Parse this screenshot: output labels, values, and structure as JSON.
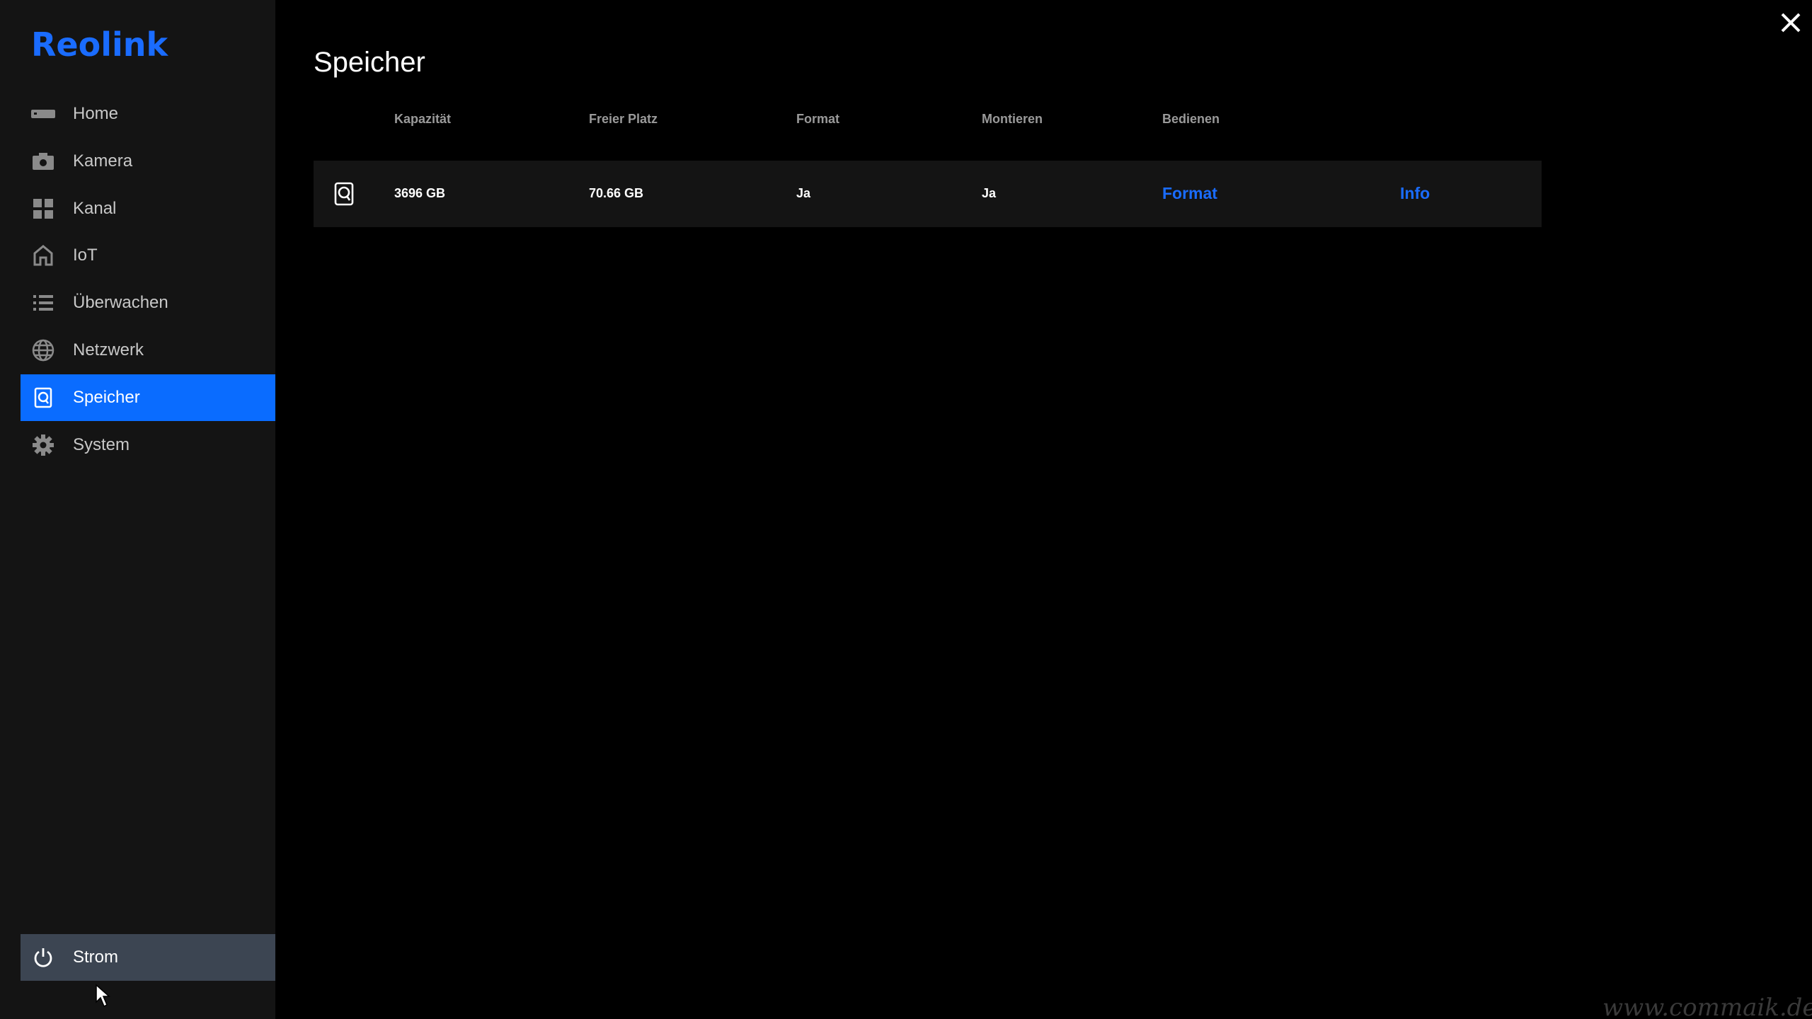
{
  "app": {
    "logo_text": "Reolink",
    "accent_color": "#1a6cff"
  },
  "sidebar": {
    "items": [
      {
        "label": "Home",
        "icon": "nvr-device-icon"
      },
      {
        "label": "Kamera",
        "icon": "camera-icon"
      },
      {
        "label": "Kanal",
        "icon": "grid-icon"
      },
      {
        "label": "IoT",
        "icon": "home-iot-icon"
      },
      {
        "label": "Überwachen",
        "icon": "list-icon"
      },
      {
        "label": "Netzwerk",
        "icon": "globe-icon"
      },
      {
        "label": "Speicher",
        "icon": "storage-icon",
        "active": true
      },
      {
        "label": "System",
        "icon": "gear-icon"
      }
    ],
    "power_label": "Strom"
  },
  "main": {
    "title": "Speicher",
    "table": {
      "headers": [
        "Kapazität",
        "Freier Platz",
        "Format",
        "Montieren",
        "Bedienen"
      ],
      "rows": [
        {
          "capacity": "3696 GB",
          "free": "70.66 GB",
          "format": "Ja",
          "mount": "Ja",
          "action_format": "Format",
          "action_info": "Info"
        }
      ]
    }
  },
  "watermark": "www.commaik.de"
}
